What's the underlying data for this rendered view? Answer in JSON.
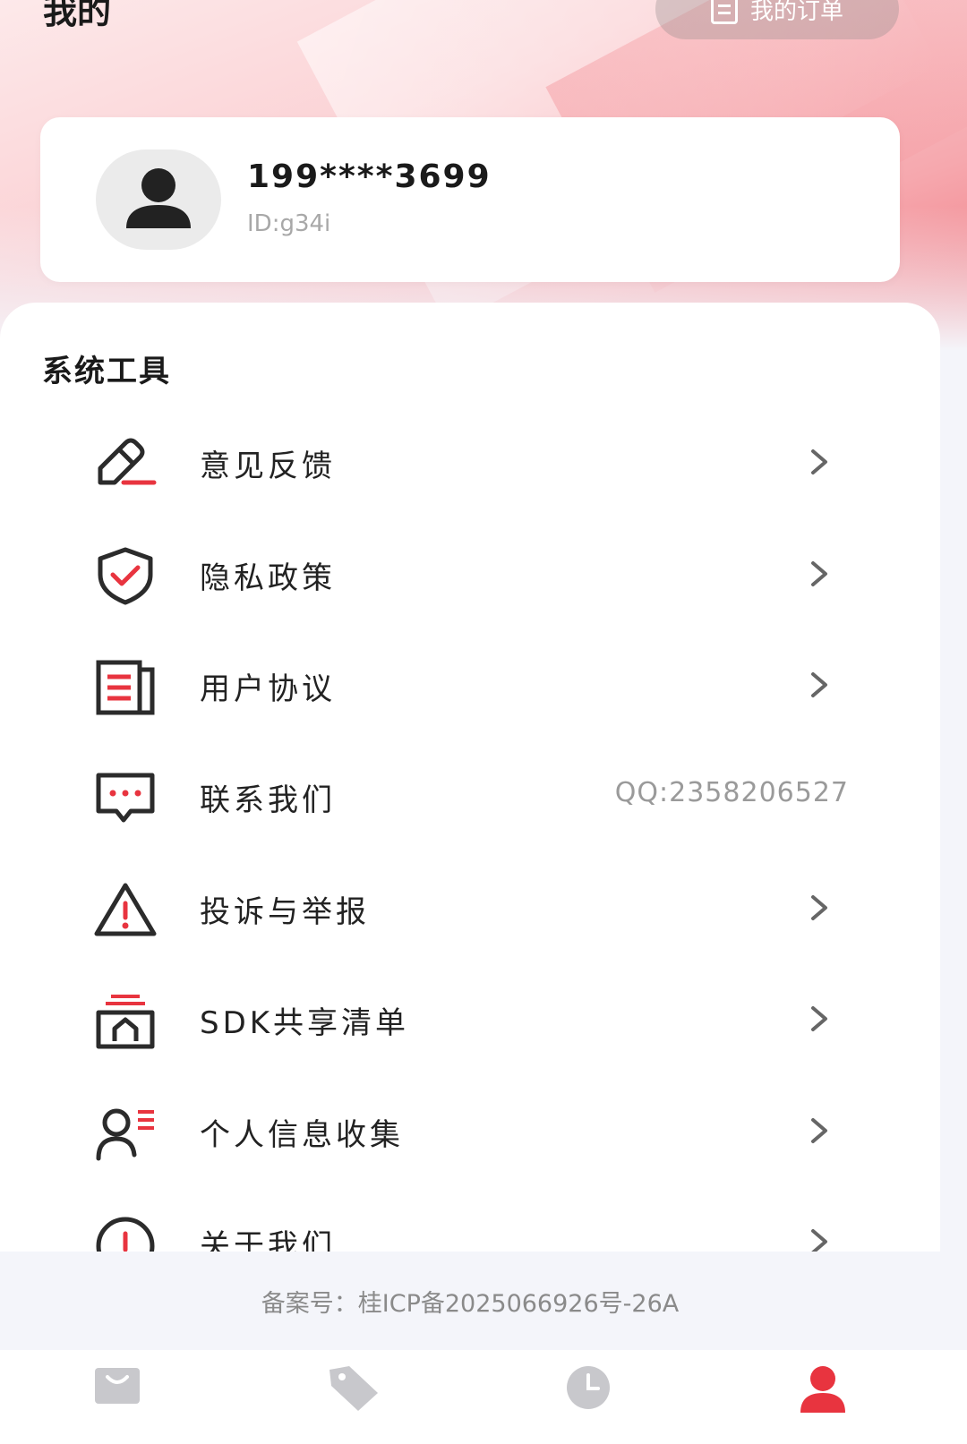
{
  "header": {
    "title": "我的",
    "orders_button": "我的订单"
  },
  "profile": {
    "phone": "199****3699",
    "id": "ID:g34i"
  },
  "tools": {
    "section_title": "系统工具",
    "items": [
      {
        "label": "意见反馈",
        "icon": "feedback-edit-icon"
      },
      {
        "label": "隐私政策",
        "icon": "shield-check-icon"
      },
      {
        "label": "用户协议",
        "icon": "document-icon"
      },
      {
        "label": "联系我们",
        "icon": "chat-bubble-icon",
        "extra": "QQ:2358206527"
      },
      {
        "label": "投诉与举报",
        "icon": "warning-icon"
      },
      {
        "label": "SDK共享清单",
        "icon": "sdk-share-icon"
      },
      {
        "label": "个人信息收集",
        "icon": "user-list-icon"
      },
      {
        "label": "关于我们",
        "icon": "info-icon"
      }
    ]
  },
  "footer": {
    "icp": "备案号：桂ICP备2025066926号-26A"
  },
  "tabbar": {
    "tabs": [
      {
        "icon": "home-bag-icon",
        "active": false
      },
      {
        "icon": "tag-icon",
        "active": false
      },
      {
        "icon": "clock-icon",
        "active": false
      },
      {
        "icon": "user-icon",
        "active": true
      }
    ]
  },
  "colors": {
    "accent": "#e8343f",
    "icon_dark": "#2b2b2b",
    "tab_inactive": "#c8c8cc"
  }
}
